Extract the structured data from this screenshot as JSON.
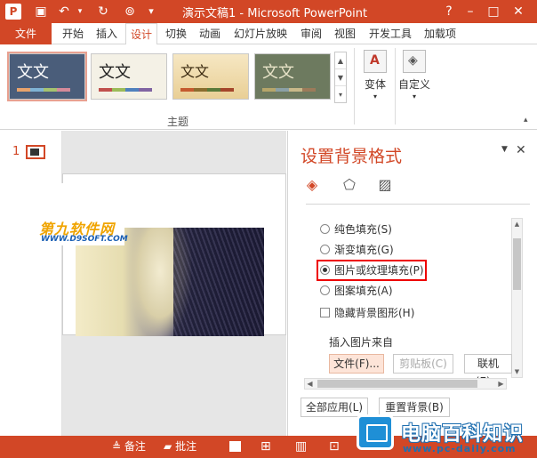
{
  "titlebar": {
    "title": "演示文稿1 - Microsoft PowerPoint",
    "help": "?",
    "minimize": "–",
    "restore": "□",
    "close": "✕"
  },
  "tabs": [
    "文件",
    "开始",
    "插入",
    "设计",
    "切换",
    "动画",
    "幻灯片放映",
    "审阅",
    "视图",
    "开发工具",
    "加载项"
  ],
  "ribbon": {
    "themes": [
      "文文",
      "文文",
      "文文",
      "文文"
    ],
    "group_label": "主题",
    "variant_label": "变体",
    "customize_label": "自定义"
  },
  "thumbnails": {
    "slide_number": "1"
  },
  "watermark": {
    "text": "第九软件网",
    "url": "WWW.D9SOFT.COM"
  },
  "panel": {
    "title": "设置背景格式",
    "fill_options": [
      {
        "label": "纯色填充(S)",
        "selected": false
      },
      {
        "label": "渐变填充(G)",
        "selected": false
      },
      {
        "label": "图片或纹理填充(P)",
        "selected": true
      },
      {
        "label": "图案填充(A)",
        "selected": false
      }
    ],
    "hide_graphics_label": "隐藏背景图形(H)",
    "insert_from_label": "插入图片来自",
    "file_button": "文件(F)...",
    "clipboard_button": "剪贴板(C)",
    "online_button": "联机(E)...",
    "apply_all_button": "全部应用(L)",
    "reset_button": "重置背景(B)"
  },
  "statusbar": {
    "notes": "备注",
    "comments": "批注"
  },
  "brand": {
    "name": "电脑百科知识",
    "url": "www.pc-daily.com"
  },
  "colors": {
    "accent": "#d24726",
    "highlight": "#e00000"
  }
}
